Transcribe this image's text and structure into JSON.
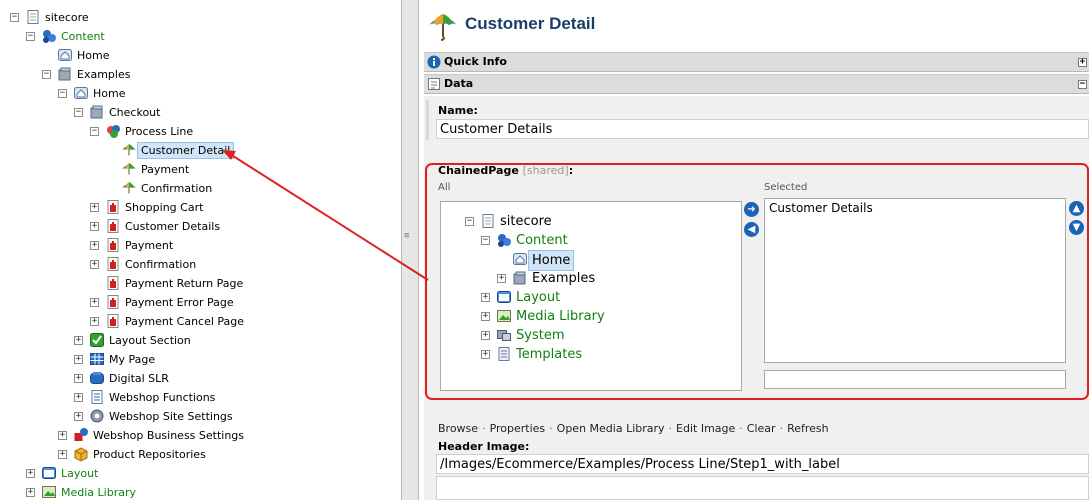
{
  "tree": {
    "nodes": [
      {
        "label": "sitecore",
        "icon": "page-icon",
        "toggle": "−",
        "green": false
      },
      {
        "label": "Content",
        "icon": "content-icon",
        "toggle": "−",
        "green": true
      },
      {
        "label": "Home",
        "icon": "home-icon",
        "toggle": "",
        "green": false
      },
      {
        "label": "Examples",
        "icon": "examples-icon",
        "toggle": "−",
        "green": false
      },
      {
        "label": "Home",
        "icon": "home-icon",
        "toggle": "−",
        "green": false
      },
      {
        "label": "Checkout",
        "icon": "checkout-icon",
        "toggle": "−",
        "green": false
      },
      {
        "label": "Process Line",
        "icon": "process-line-icon",
        "toggle": "−",
        "green": false
      },
      {
        "label": "Customer Detail",
        "icon": "umbrella-icon",
        "toggle": "",
        "green": false,
        "selected": true
      },
      {
        "label": "Payment",
        "icon": "umbrella-icon",
        "toggle": "",
        "green": false
      },
      {
        "label": "Confirmation",
        "icon": "umbrella-icon",
        "toggle": "",
        "green": false
      },
      {
        "label": "Shopping Cart",
        "icon": "red-doc-icon",
        "toggle": "+",
        "green": false
      },
      {
        "label": "Customer Details",
        "icon": "red-doc-icon",
        "toggle": "+",
        "green": false
      },
      {
        "label": "Payment",
        "icon": "red-doc-icon",
        "toggle": "+",
        "green": false
      },
      {
        "label": "Confirmation",
        "icon": "red-doc-icon",
        "toggle": "+",
        "green": false
      },
      {
        "label": "Payment Return Page",
        "icon": "red-doc-icon",
        "toggle": "",
        "green": false
      },
      {
        "label": "Payment Error Page",
        "icon": "red-doc-icon",
        "toggle": "+",
        "green": false
      },
      {
        "label": "Payment Cancel Page",
        "icon": "red-doc-icon",
        "toggle": "+",
        "green": false
      },
      {
        "label": "Layout Section",
        "icon": "layout-section-icon",
        "toggle": "+",
        "green": false
      },
      {
        "label": "My Page",
        "icon": "grid-icon",
        "toggle": "+",
        "green": false
      },
      {
        "label": "Digital SLR",
        "icon": "camera-icon",
        "toggle": "+",
        "green": false
      },
      {
        "label": "Webshop Functions",
        "icon": "functions-icon",
        "toggle": "+",
        "green": false
      },
      {
        "label": "Webshop Site Settings",
        "icon": "settings-icon",
        "toggle": "+",
        "green": false
      },
      {
        "label": "Webshop Business Settings",
        "icon": "business-settings-icon",
        "toggle": "+",
        "green": false
      },
      {
        "label": "Product Repositories",
        "icon": "box-icon",
        "toggle": "+",
        "green": false
      },
      {
        "label": "Layout",
        "icon": "layout-icon",
        "toggle": "+",
        "green": true
      },
      {
        "label": "Media Library",
        "icon": "media-icon",
        "toggle": "+",
        "green": true
      }
    ]
  },
  "editor": {
    "title": "Customer Detail",
    "sections": {
      "quick_info": "Quick Info",
      "data": "Data"
    },
    "name_field": {
      "label": "Name:",
      "value": "Customer Details"
    },
    "chained_page": {
      "label": "ChainedPage",
      "shared_hint": "[shared]",
      "colon": ":",
      "all_label": "All",
      "selected_label": "Selected",
      "all_tree": [
        {
          "label": "sitecore",
          "icon": "page-icon",
          "toggle": "−",
          "green": false
        },
        {
          "label": "Content",
          "icon": "content-icon",
          "toggle": "−",
          "green": true
        },
        {
          "label": "Home",
          "icon": "home-icon",
          "toggle": "",
          "green": false,
          "selected": true
        },
        {
          "label": "Examples",
          "icon": "examples-icon",
          "toggle": "+",
          "green": false
        },
        {
          "label": "Layout",
          "icon": "layout-icon",
          "toggle": "+",
          "green": true
        },
        {
          "label": "Media Library",
          "icon": "media-icon",
          "toggle": "+",
          "green": true
        },
        {
          "label": "System",
          "icon": "system-icon",
          "toggle": "+",
          "green": true
        },
        {
          "label": "Templates",
          "icon": "templates-icon",
          "toggle": "+",
          "green": true
        }
      ],
      "selected_items": [
        "Customer Details"
      ]
    },
    "toolbar_links": [
      "Browse",
      "Properties",
      "Open Media Library",
      "Edit Image",
      "Clear",
      "Refresh"
    ],
    "header_image": {
      "label": "Header Image:",
      "value": "/Images/Ecommerce/Examples/Process Line/Step1_with_label"
    }
  },
  "colors": {
    "accent_red": "#e02020",
    "title_blue": "#1a3e6a",
    "tree_green": "#108010",
    "button_blue": "#1b63b5"
  }
}
